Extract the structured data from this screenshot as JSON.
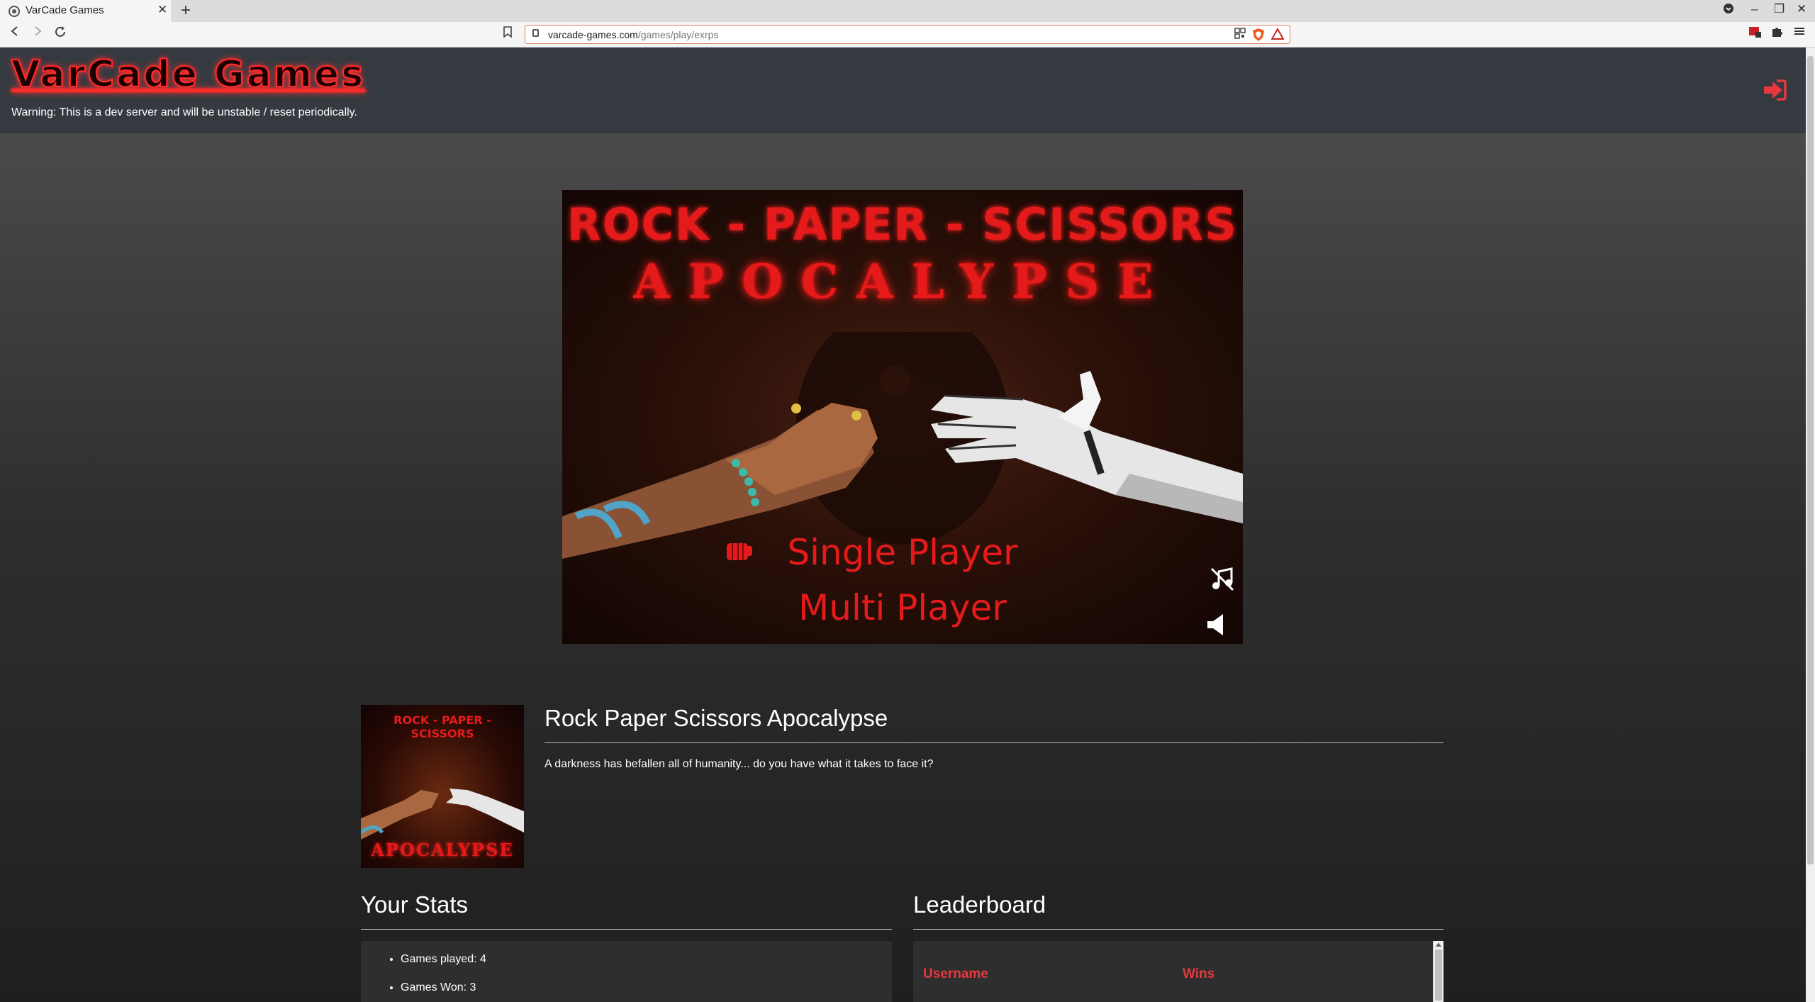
{
  "browser": {
    "tab_title": "VarCade Games",
    "tab_close": "✕",
    "new_tab": "+",
    "url_domain": "varcade-games.com",
    "url_path": "/games/play/exrps",
    "window_controls": [
      "‒",
      "❐",
      "✕"
    ]
  },
  "header": {
    "logo": "VarCade Games",
    "warning": "Warning: This is a dev server and will be unstable / reset periodically."
  },
  "game_canvas": {
    "title_line1": "ROCK - PAPER - SCISSORS",
    "title_line2": "APOCALYPSE",
    "menu_single": "Single Player",
    "menu_multi": "Multi Player",
    "icons": [
      "fist-icon",
      "music-off-icon",
      "sound-icon"
    ]
  },
  "game_info": {
    "thumb_top": "ROCK - PAPER - SCISSORS",
    "thumb_bottom": "APOCALYPSE",
    "name": "Rock Paper Scissors Apocalypse",
    "description": "A darkness has befallen all of humanity... do you have what it takes to face it?"
  },
  "stats": {
    "title": "Your Stats",
    "items": [
      "Games played: 4",
      "Games Won: 3"
    ]
  },
  "leaderboard": {
    "title": "Leaderboard",
    "columns": [
      "Username",
      "Wins"
    ]
  },
  "colors": {
    "accent_red": "#e51b1b",
    "header_bg": "#343a40",
    "leaderboard_header": "#e8383d"
  }
}
